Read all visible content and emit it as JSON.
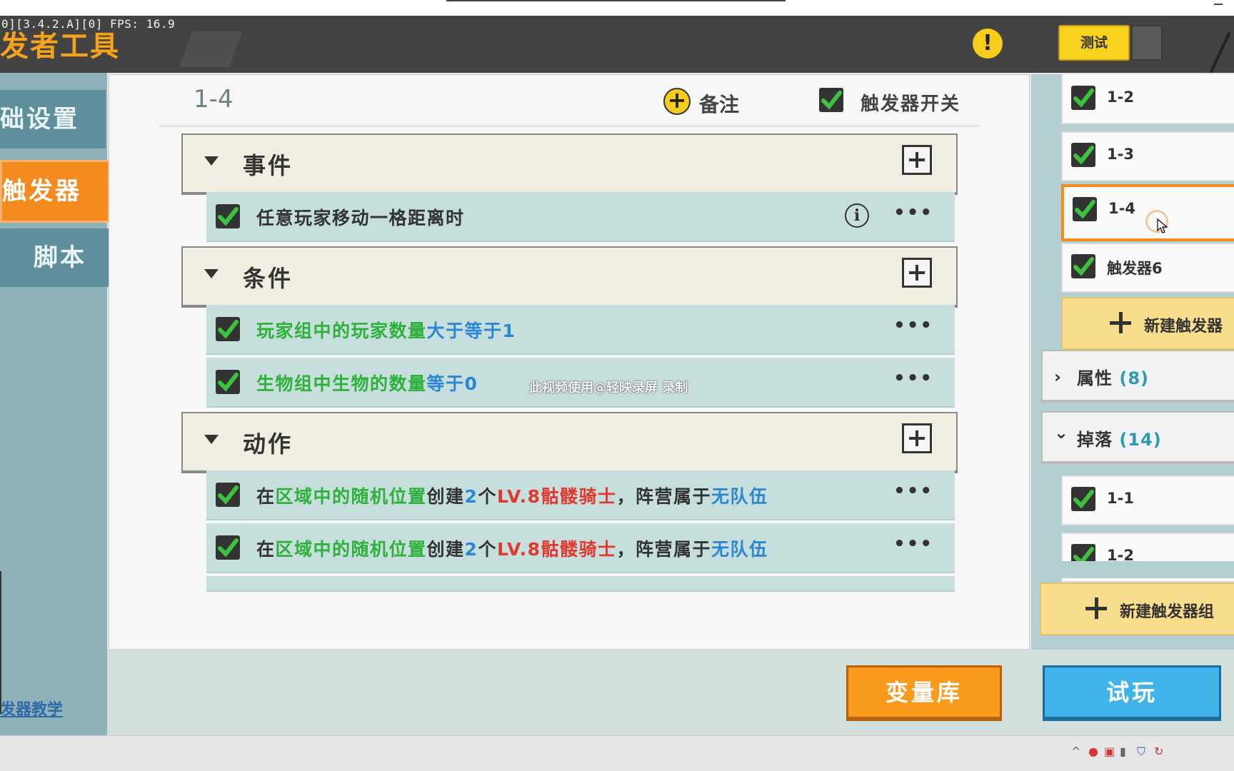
{
  "header": {
    "fps_text": "0][3.4.2.A][0] FPS: 16.9",
    "app_title": "发者工具",
    "alert_glyph": "!",
    "test_button": "测试"
  },
  "sidebar": {
    "tabs": [
      {
        "label": "础设置",
        "active": false
      },
      {
        "label": "触发器",
        "active": true
      },
      {
        "label": "脚本",
        "active": false
      }
    ],
    "tutorial_link": "发器教学"
  },
  "editor": {
    "trigger_title": "1-4",
    "note_label": "备注",
    "switch_label": "触发器开关",
    "switch_checked": true,
    "sections": {
      "event": "事件",
      "condition": "条件",
      "action": "动作"
    },
    "events": [
      {
        "text": "任意玩家移动一格距离时",
        "checked": true
      }
    ],
    "conditions": [
      {
        "part1": "玩家组中的玩家数量",
        "part2": "大于等于1",
        "checked": true
      },
      {
        "part1": "生物组中生物的数量",
        "part2": "等于0",
        "checked": true
      }
    ],
    "actions": [
      {
        "p1": "在",
        "p2": "区域中的随机位置",
        "p3": "创建",
        "p4": "2",
        "p5": "个",
        "p6": "LV.8骷髅骑士",
        "p7": "，阵营属于",
        "p8": "无队伍",
        "checked": true
      },
      {
        "p1": "在",
        "p2": "区域中的随机位置",
        "p3": "创建",
        "p4": "2",
        "p5": "个",
        "p6": "LV.8骷髅骑士",
        "p7": "，阵营属于",
        "p8": "无队伍",
        "checked": true
      }
    ],
    "more_glyph": "•••",
    "info_glyph": "i",
    "watermark": "此视频使用@轻映录屏 录制"
  },
  "right_panel": {
    "triggers": [
      {
        "label": "1-2",
        "checked": true
      },
      {
        "label": "1-3",
        "checked": true
      },
      {
        "label": "1-4",
        "checked": true,
        "active": true
      },
      {
        "label": "触发器6",
        "checked": true
      }
    ],
    "new_trigger": "新建触发器",
    "groups": [
      {
        "label": "属性",
        "count": "(8)",
        "chevron": "›"
      },
      {
        "label": "掉落",
        "count": "(14)",
        "chevron": "⌄"
      }
    ],
    "group_items": [
      {
        "label": "1-1",
        "checked": true
      },
      {
        "label": "1-2",
        "checked": true
      }
    ],
    "new_group": "新建触发器组"
  },
  "bottom": {
    "variables_button": "变量库",
    "play_button": "试玩"
  },
  "colors": {
    "orange": "#f58a1f",
    "green_text": "#2db13a",
    "blue_text": "#2c86d4",
    "red_text": "#e0392f",
    "yellow": "#f8d21e"
  }
}
